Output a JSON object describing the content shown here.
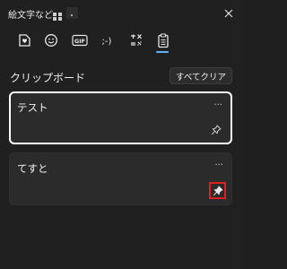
{
  "window": {
    "title": "絵文字など",
    "close_icon": "close-icon"
  },
  "tabs": [
    {
      "name": "kaomoji-heart",
      "icon": "heart-sticker-icon"
    },
    {
      "name": "emoji",
      "icon": "smiley-icon"
    },
    {
      "name": "gif",
      "icon": "gif-icon",
      "label": "GIF"
    },
    {
      "name": "kaomoji",
      "icon": "kaomoji-icon",
      "label": ";-)"
    },
    {
      "name": "symbols",
      "icon": "symbols-icon"
    },
    {
      "name": "clipboard",
      "icon": "clipboard-icon",
      "selected": true
    }
  ],
  "clipboard": {
    "title": "クリップボード",
    "clear_all_label": "すべてクリア",
    "items": [
      {
        "text": "テスト",
        "more": "···",
        "pinned": false
      },
      {
        "text": "てすと",
        "more": "···",
        "pinned": true
      }
    ]
  },
  "colors": {
    "background": "#202020",
    "card": "#2b2b2b",
    "accent": "#62b1ff",
    "highlight": "#e21f1f"
  }
}
